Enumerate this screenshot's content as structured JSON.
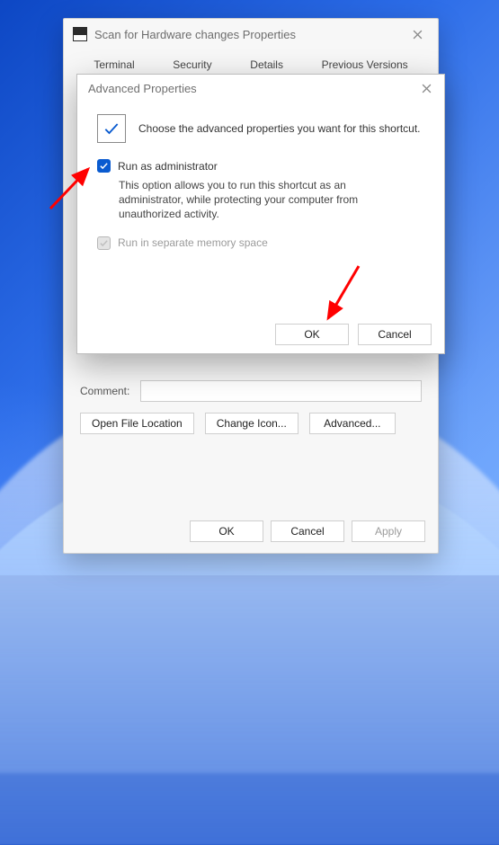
{
  "parent": {
    "title": "Scan for Hardware changes Properties",
    "tabs": [
      "Terminal",
      "Security",
      "Details",
      "Previous Versions"
    ],
    "comment_label": "Comment:",
    "buttons": {
      "open_location": "Open File Location",
      "change_icon": "Change Icon...",
      "advanced": "Advanced..."
    },
    "footer": {
      "ok": "OK",
      "cancel": "Cancel",
      "apply": "Apply"
    }
  },
  "modal": {
    "title": "Advanced Properties",
    "intro": "Choose the advanced properties you want for this shortcut.",
    "run_as_admin": {
      "label": "Run as administrator",
      "desc": "This option allows you to run this shortcut as an administrator, while protecting your computer from unauthorized activity."
    },
    "run_sep_mem": {
      "label": "Run in separate memory space"
    },
    "footer": {
      "ok": "OK",
      "cancel": "Cancel"
    }
  }
}
